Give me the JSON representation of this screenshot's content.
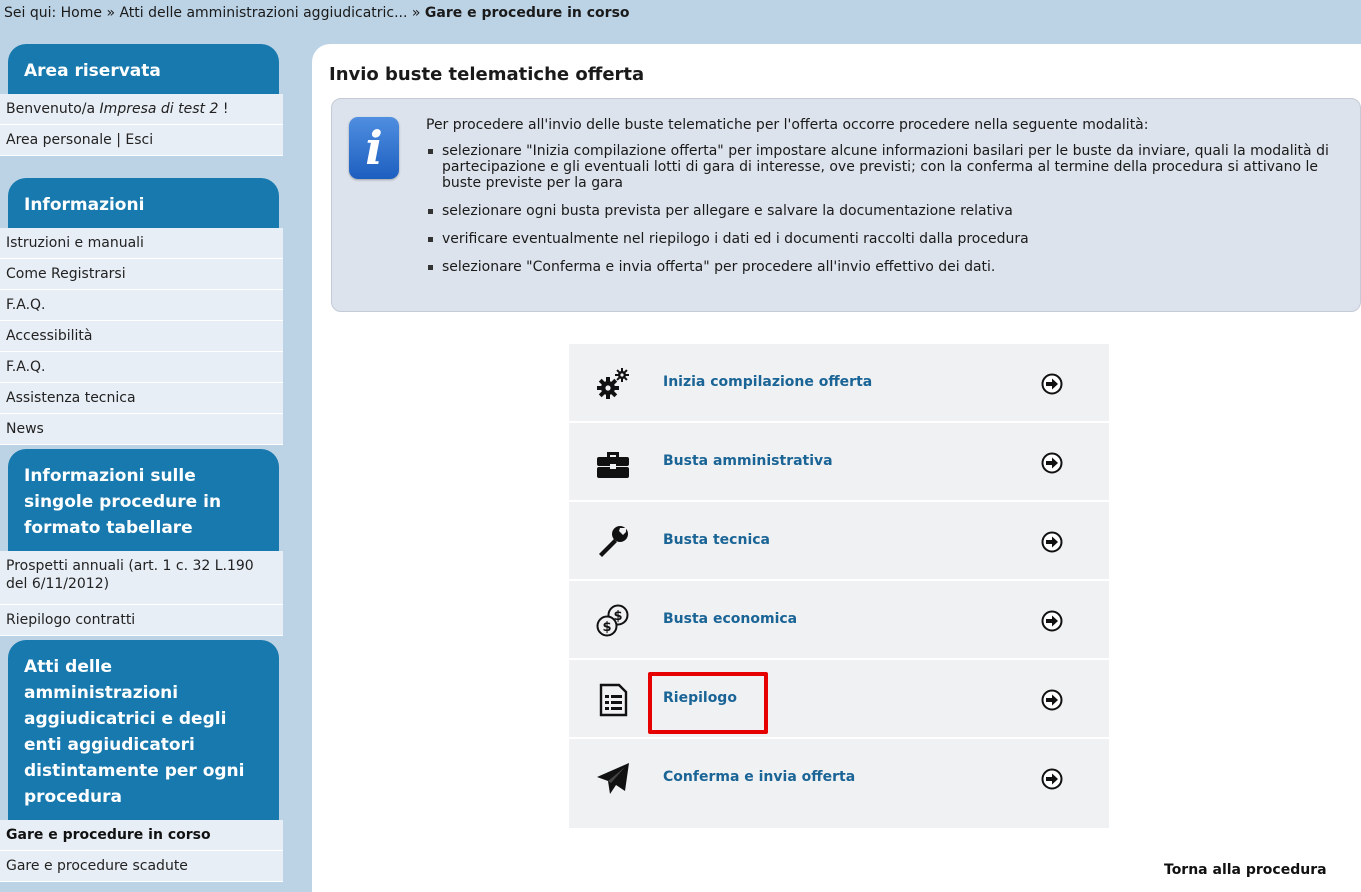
{
  "breadcrumb": {
    "prefix": "Sei qui: ",
    "home": "Home",
    "sep1": " » ",
    "parent": "Atti delle amministrazioni aggiudicatric...",
    "sep2": " » ",
    "current": "Gare e procedure in corso"
  },
  "sidebar": {
    "area_riservata": {
      "title": "Area riservata",
      "welcome_prefix": "Benvenuto/a ",
      "welcome_user": "Impresa di test 2",
      "welcome_suffix": " !",
      "personal": "Area personale",
      "divider": " | ",
      "logout": "Esci"
    },
    "informazioni": {
      "title": "Informazioni",
      "items": [
        "Istruzioni e manuali",
        "Come Registrarsi",
        "F.A.Q.",
        "Accessibilità",
        "F.A.Q.",
        "Assistenza tecnica",
        "News"
      ]
    },
    "tabellare": {
      "title": "Informazioni sulle singole procedure in formato tabellare",
      "items": [
        "Prospetti annuali (art. 1 c. 32 L.190 del 6/11/2012)",
        "Riepilogo contratti"
      ]
    },
    "atti": {
      "title": "Atti delle amministrazioni aggiudicatrici e degli enti aggiudicatori distintamente per ogni procedura",
      "items": [
        "Gare e procedure in corso",
        "Gare e procedure scadute"
      ]
    }
  },
  "main": {
    "title": "Invio buste telematiche offerta",
    "info": {
      "icon": "info-icon",
      "intro": "Per procedere all'invio delle buste telematiche per l'offerta occorre procedere nella seguente modalità:",
      "bullets": [
        "selezionare \"Inizia compilazione offerta\" per impostare alcune informazioni basilari per le buste da inviare, quali la modalità di partecipazione e gli eventuali lotti di gara di interesse, ove previsti; con la conferma al termine della procedura si attivano le buste previste per la gara",
        "selezionare ogni busta prevista per allegare e salvare la documentazione relativa",
        "verificare eventualmente nel riepilogo i dati ed i documenti raccolti dalla procedura",
        "selezionare \"Conferma e invia offerta\" per procedere all'invio effettivo dei dati."
      ]
    },
    "actions": [
      {
        "label": "Inizia compilazione offerta",
        "icon": "gears-icon"
      },
      {
        "label": "Busta amministrativa",
        "icon": "briefcase-icon"
      },
      {
        "label": "Busta tecnica",
        "icon": "wrench-icon"
      },
      {
        "label": "Busta economica",
        "icon": "money-icon"
      },
      {
        "label": "Riepilogo",
        "icon": "list-document-icon"
      },
      {
        "label": "Conferma e invia offerta",
        "icon": "paper-plane-icon"
      }
    ],
    "back_link": "Torna alla procedura"
  },
  "colors": {
    "background": "#bcd3e5",
    "sidebar_header": "#1779ad",
    "link": "#1a6496",
    "highlight": "#e60000"
  }
}
